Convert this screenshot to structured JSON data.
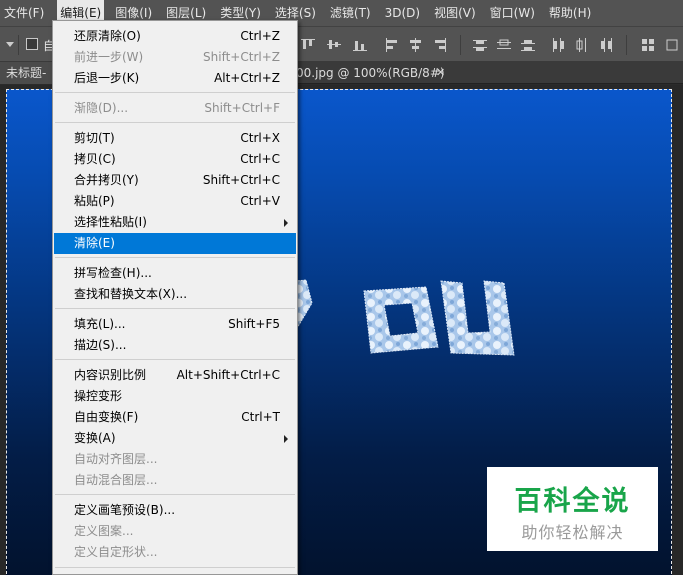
{
  "menubar": {
    "items": [
      {
        "label": "文件(F)"
      },
      {
        "label": "编辑(E)",
        "active": true
      },
      {
        "label": "图像(I)"
      },
      {
        "label": "图层(L)"
      },
      {
        "label": "类型(Y)"
      },
      {
        "label": "选择(S)"
      },
      {
        "label": "滤镜(T)"
      },
      {
        "label": "3D(D)"
      },
      {
        "label": "视图(V)"
      },
      {
        "label": "窗口(W)"
      },
      {
        "label": "帮助(H)"
      }
    ]
  },
  "options_bar": {
    "auto_select_label": "自"
  },
  "tabs": {
    "left_title": "未标题-",
    "right_title": "00.jpg @ 100%(RGB/8#)",
    "close_glyph": "✕"
  },
  "edit_menu": {
    "items": [
      {
        "label": "还原清除(O)",
        "shortcut": "Ctrl+Z"
      },
      {
        "label": "前进一步(W)",
        "shortcut": "Shift+Ctrl+Z",
        "disabled": true
      },
      {
        "label": "后退一步(K)",
        "shortcut": "Alt+Ctrl+Z"
      },
      {
        "label": "渐隐(D)...",
        "shortcut": "Shift+Ctrl+F",
        "disabled": true
      },
      {
        "label": "剪切(T)",
        "shortcut": "Ctrl+X"
      },
      {
        "label": "拷贝(C)",
        "shortcut": "Ctrl+C"
      },
      {
        "label": "合并拷贝(Y)",
        "shortcut": "Shift+Ctrl+C"
      },
      {
        "label": "粘贴(P)",
        "shortcut": "Ctrl+V"
      },
      {
        "label": "选择性粘贴(I)",
        "shortcut": "",
        "submenu": true
      },
      {
        "label": "清除(E)",
        "shortcut": "",
        "highlighted": true
      },
      {
        "label": "拼写检查(H)...",
        "shortcut": ""
      },
      {
        "label": "查找和替换文本(X)...",
        "shortcut": ""
      },
      {
        "label": "填充(L)...",
        "shortcut": "Shift+F5"
      },
      {
        "label": "描边(S)...",
        "shortcut": ""
      },
      {
        "label": "内容识别比例",
        "shortcut": "Alt+Shift+Ctrl+C"
      },
      {
        "label": "操控变形",
        "shortcut": ""
      },
      {
        "label": "自由变换(F)",
        "shortcut": "Ctrl+T"
      },
      {
        "label": "变换(A)",
        "shortcut": "",
        "submenu": true
      },
      {
        "label": "自动对齐图层...",
        "shortcut": "",
        "disabled": true
      },
      {
        "label": "自动混合图层...",
        "shortcut": "",
        "disabled": true
      },
      {
        "label": "定义画笔预设(B)...",
        "shortcut": ""
      },
      {
        "label": "定义图案...",
        "shortcut": "",
        "disabled": true
      },
      {
        "label": "定义自定形状...",
        "shortcut": "",
        "disabled": true
      }
    ]
  },
  "canvas": {
    "cloud_text": "you"
  },
  "watermark": {
    "title": "百科全说",
    "subtitle": "助你轻松解决"
  }
}
